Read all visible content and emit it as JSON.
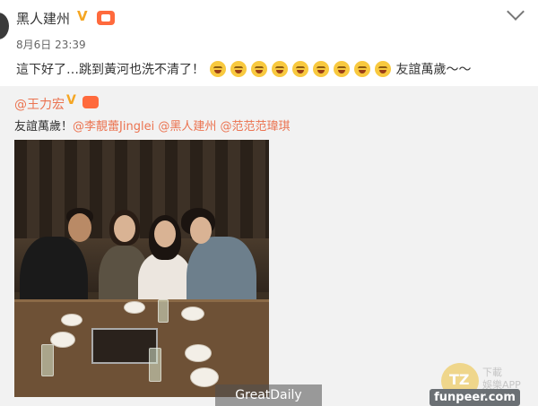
{
  "header": {
    "username": "黑人建州",
    "verified_mark": "V",
    "timestamp": "8月6日 23:39",
    "more_icon": "chevron-down-icon"
  },
  "post": {
    "text": "這下好了…跳到黃河也洗不清了！",
    "emoji_icon": "laugh-cry-emoji",
    "emoji_count": 9,
    "trailing_text": "友誼萬歲～～"
  },
  "repost": {
    "author": "@王力宏",
    "verified_mark": "V",
    "text_prefix": "友誼萬歲！",
    "mentions": [
      "@李靚蕾Jinglei",
      "@黑人建州",
      "@范范范瑋琪"
    ]
  },
  "watermarks": {
    "app_text_line1": "下載",
    "app_text_line2": "娛樂APP",
    "greatdaily": "GreatDaily",
    "funpeer": "funpeer.com"
  },
  "colors": {
    "mention": "#eb7350",
    "verified": "#f5a623",
    "repost_bg": "#f2f2f2"
  }
}
